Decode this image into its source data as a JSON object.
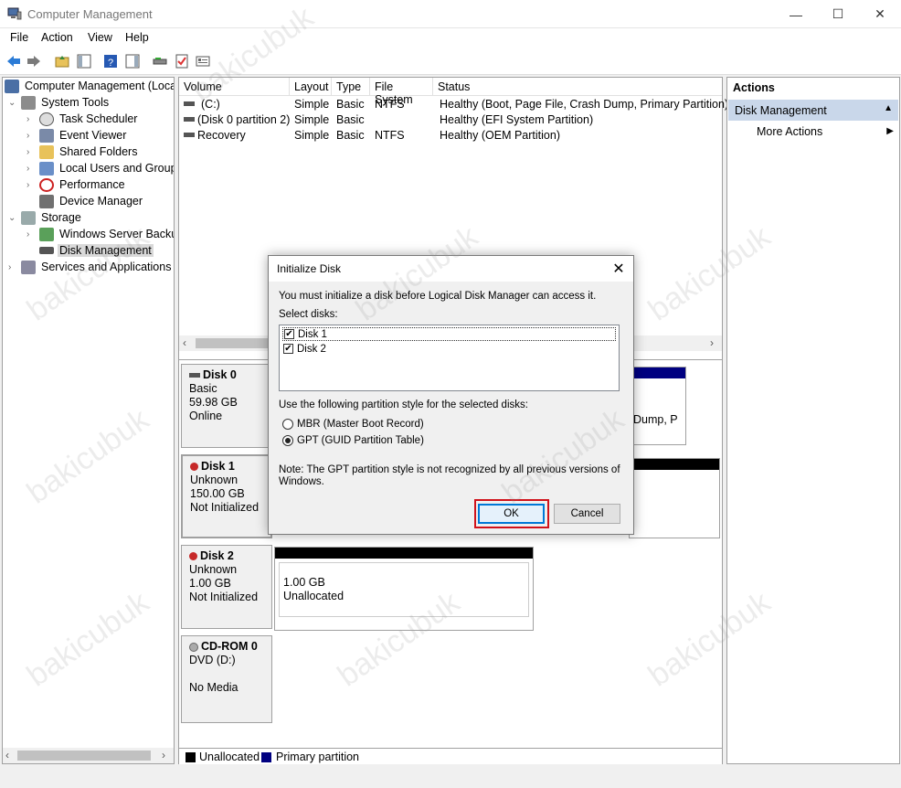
{
  "window": {
    "title": "Computer Management",
    "minimize": "—",
    "maximize": "☐",
    "close": "✕"
  },
  "menu": [
    "File",
    "Action",
    "View",
    "Help"
  ],
  "tree": {
    "root": "Computer Management (Local",
    "system_tools": "System Tools",
    "task_scheduler": "Task Scheduler",
    "event_viewer": "Event Viewer",
    "shared_folders": "Shared Folders",
    "local_users": "Local Users and Groups",
    "performance": "Performance",
    "device_manager": "Device Manager",
    "storage": "Storage",
    "wsb": "Windows Server Backup",
    "disk_management": "Disk Management",
    "services": "Services and Applications"
  },
  "volumes": {
    "headers": [
      "Volume",
      "Layout",
      "Type",
      "File System",
      "Status"
    ],
    "rows": [
      {
        "volume": "(C:)",
        "layout": "Simple",
        "type": "Basic",
        "fs": "NTFS",
        "status": "Healthy (Boot, Page File, Crash Dump, Primary Partition)"
      },
      {
        "volume": "(Disk 0 partition 2)",
        "layout": "Simple",
        "type": "Basic",
        "fs": "",
        "status": "Healthy (EFI System Partition)"
      },
      {
        "volume": "Recovery",
        "layout": "Simple",
        "type": "Basic",
        "fs": "NTFS",
        "status": "Healthy (OEM Partition)"
      }
    ]
  },
  "disks": {
    "disk0": {
      "name": "Disk 0",
      "type": "Basic",
      "size": "59.98 GB",
      "state": "Online",
      "partial": "Dump, P"
    },
    "disk1": {
      "name": "Disk 1",
      "type": "Unknown",
      "size": "150.00 GB",
      "state": "Not Initialized"
    },
    "disk2": {
      "name": "Disk 2",
      "type": "Unknown",
      "size": "1.00 GB",
      "state": "Not Initialized",
      "part_size": "1.00 GB",
      "part_state": "Unallocated"
    },
    "cdrom": {
      "name": "CD-ROM 0",
      "drive": "DVD (D:)",
      "state": "No Media"
    }
  },
  "legend": {
    "unallocated": "Unallocated",
    "primary": "Primary partition",
    "unallocated_color": "#000000",
    "primary_color": "#000080"
  },
  "actions": {
    "title": "Actions",
    "selected": "Disk Management",
    "more": "More Actions"
  },
  "dialog": {
    "title": "Initialize Disk",
    "intro": "You must initialize a disk before Logical Disk Manager can access it.",
    "select_label": "Select disks:",
    "disks": [
      "Disk 1",
      "Disk 2"
    ],
    "style_label": "Use the following partition style for the selected disks:",
    "mbr": "MBR (Master Boot Record)",
    "gpt": "GPT (GUID Partition Table)",
    "note_line1": "Note: The GPT partition style is not recognized by all previous versions of",
    "note_line2": "Windows.",
    "ok": "OK",
    "cancel": "Cancel"
  },
  "watermark": "bakicubuk",
  "colors": {
    "selection": "#c9d7ea",
    "ok_highlight": "#d0121b",
    "accent": "#0078d7"
  }
}
